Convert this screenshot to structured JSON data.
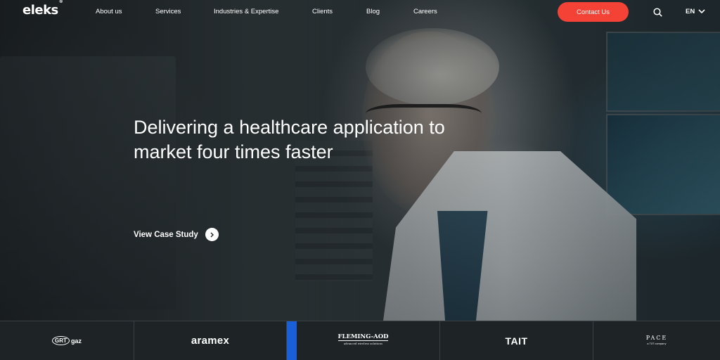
{
  "header": {
    "logo": "eleks",
    "logo_mark": "®",
    "nav": [
      "About us",
      "Services",
      "Industries & Expertise",
      "Clients",
      "Blog",
      "Careers"
    ],
    "contact_label": "Contact Us",
    "search_icon": "search-icon",
    "language": "EN",
    "accent_color": "#f44336"
  },
  "hero": {
    "title": "Delivering a healthcare application to market four times faster",
    "cta_label": "View Case Study",
    "cta_icon": "chevron-right-icon"
  },
  "clients": {
    "active_color": "#1a5fd6",
    "items": [
      {
        "name": "GRTgaz",
        "mark": "GRT",
        "suffix": "gaz"
      },
      {
        "name": "aramex"
      },
      {
        "name": "FLEMING-AOD",
        "tagline": "advanced wireless solutions"
      },
      {
        "name": "TAIT"
      },
      {
        "name": "PACE",
        "tagline": "a TXT company"
      }
    ]
  }
}
